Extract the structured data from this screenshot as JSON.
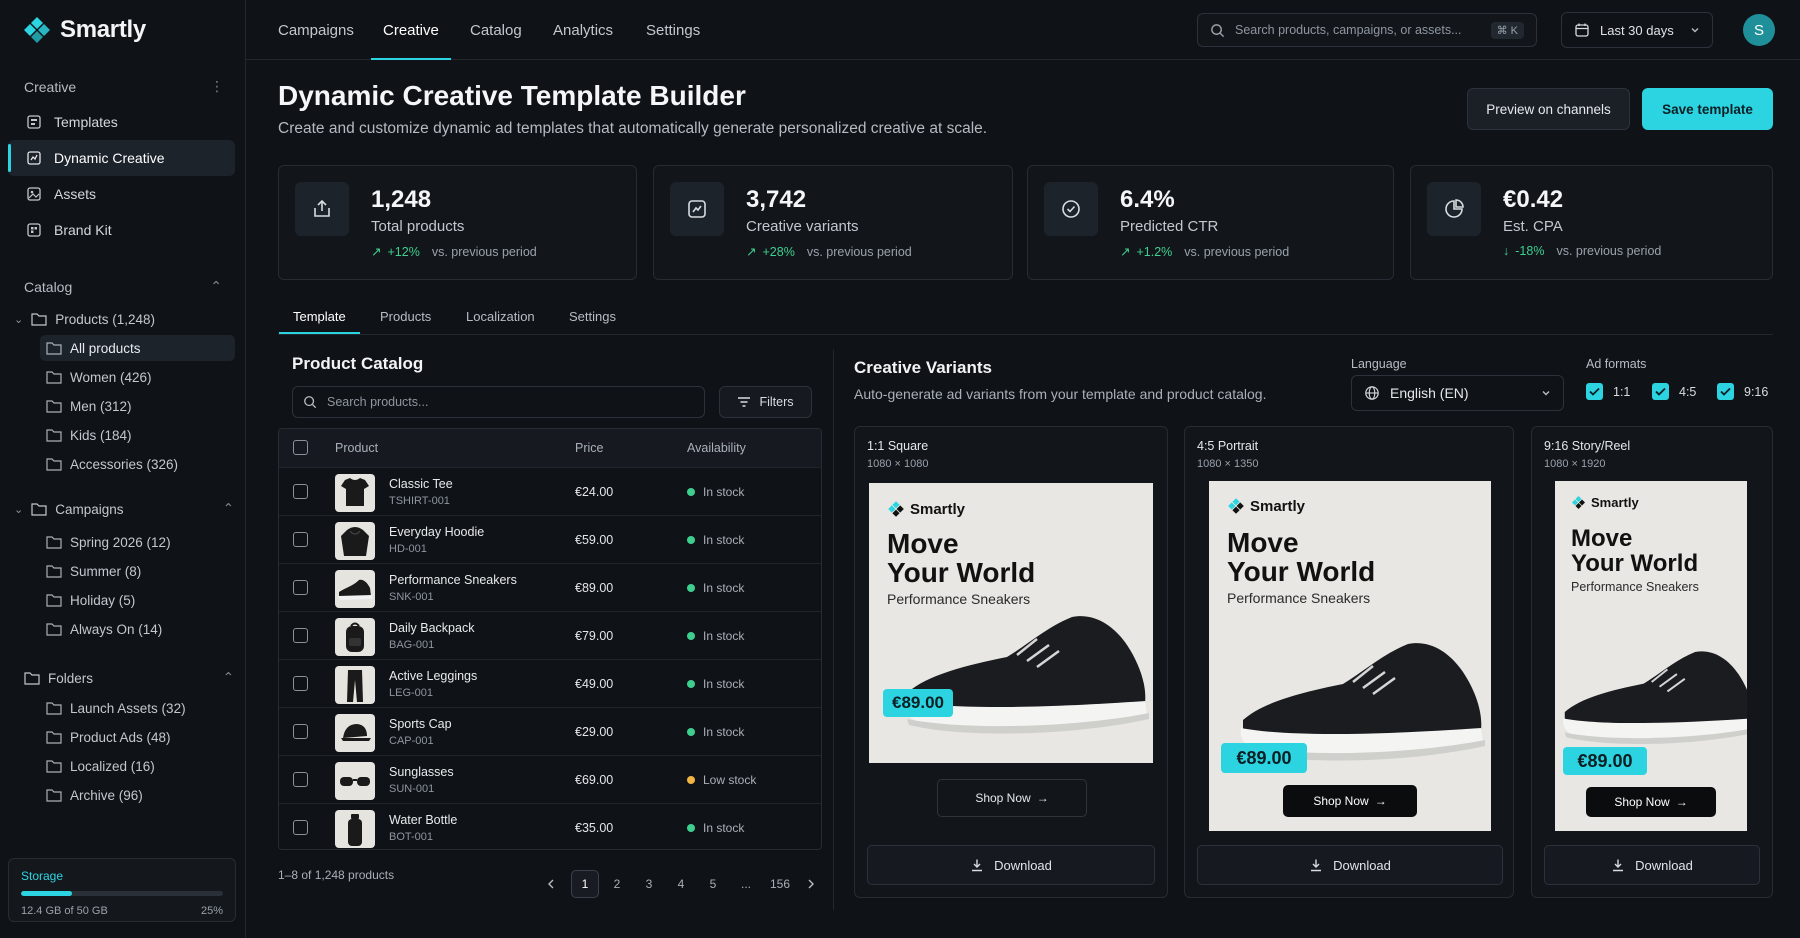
{
  "brand": {
    "name": "Smartly",
    "accent": "#2bd4e0"
  },
  "sidebar": {
    "creative_header": "Creative",
    "creative_items": [
      {
        "label": "Templates",
        "icon": "template-icon"
      },
      {
        "label": "Dynamic Creative",
        "icon": "dynamic-icon",
        "active": true
      },
      {
        "label": "Assets",
        "icon": "image-icon"
      },
      {
        "label": "Brand Kit",
        "icon": "brandkit-icon"
      }
    ],
    "catalog_header": "Catalog",
    "products_group": "Products (1,248)",
    "products_children": [
      "All products",
      "Women (426)",
      "Men (312)",
      "Kids (184)",
      "Accessories (326)"
    ],
    "campaigns_group": "Campaigns",
    "campaigns_children": [
      "Spring 2026 (12)",
      "Summer (8)",
      "Holiday (5)",
      "Always On (14)"
    ],
    "folders_group": "Folders",
    "folders_children": [
      "Launch Assets (32)",
      "Product Ads (48)",
      "Localized (16)",
      "Archive (96)"
    ],
    "storage": {
      "label": "Storage",
      "used": "12.4 GB of 50 GB",
      "percent": "25%",
      "fraction": 0.25
    }
  },
  "topnav": {
    "tabs": [
      "Campaigns",
      "Creative",
      "Catalog",
      "Analytics",
      "Settings"
    ],
    "active": "Creative",
    "search_placeholder": "Search products, campaigns, or assets...",
    "shortcut": "⌘ K",
    "date_range": "Last 30 days",
    "avatar_initial": "S"
  },
  "header": {
    "title": "Dynamic Creative Template Builder",
    "subtitle": "Create and customize dynamic ad templates that automatically generate personalized creative at scale.",
    "preview_button": "Preview on channels",
    "save_button": "Save template"
  },
  "stats": [
    {
      "value": "1,248",
      "label": "Total products",
      "change": "+12%",
      "compare": "vs. previous period",
      "direction": "up"
    },
    {
      "value": "3,742",
      "label": "Creative variants",
      "change": "+28%",
      "compare": "vs. previous period",
      "direction": "up"
    },
    {
      "value": "6.4%",
      "label": "Predicted CTR",
      "change": "+1.2%",
      "compare": "vs. previous period",
      "direction": "up"
    },
    {
      "value": "€0.42",
      "label": "Est. CPA",
      "change": "-18%",
      "compare": "vs. previous period",
      "direction": "down"
    }
  ],
  "subtabs": [
    "Template",
    "Products",
    "Localization",
    "Settings"
  ],
  "catalog": {
    "title": "Product Catalog",
    "search_placeholder": "Search products...",
    "filters_label": "Filters",
    "columns": {
      "product": "Product",
      "price": "Price",
      "availability": "Availability"
    },
    "rows": [
      {
        "name": "Classic Tee",
        "sku": "TSHIRT-001",
        "price": "€24.00",
        "availability": "In stock",
        "status": "ok",
        "thumb": "tshirt-icon"
      },
      {
        "name": "Everyday Hoodie",
        "sku": "HD-001",
        "price": "€59.00",
        "availability": "In stock",
        "status": "ok",
        "thumb": "hoodie-icon"
      },
      {
        "name": "Performance Sneakers",
        "sku": "SNK-001",
        "price": "€89.00",
        "availability": "In stock",
        "status": "ok",
        "thumb": "sneaker-icon"
      },
      {
        "name": "Daily Backpack",
        "sku": "BAG-001",
        "price": "€79.00",
        "availability": "In stock",
        "status": "ok",
        "thumb": "backpack-icon"
      },
      {
        "name": "Active Leggings",
        "sku": "LEG-001",
        "price": "€49.00",
        "availability": "In stock",
        "status": "ok",
        "thumb": "leggings-icon"
      },
      {
        "name": "Sports Cap",
        "sku": "CAP-001",
        "price": "€29.00",
        "availability": "In stock",
        "status": "ok",
        "thumb": "cap-icon"
      },
      {
        "name": "Sunglasses",
        "sku": "SUN-001",
        "price": "€69.00",
        "availability": "Low stock",
        "status": "low",
        "thumb": "sunglasses-icon"
      },
      {
        "name": "Water Bottle",
        "sku": "BOT-001",
        "price": "€35.00",
        "availability": "In stock",
        "status": "ok",
        "thumb": "bottle-icon"
      }
    ],
    "pagination": {
      "summary": "1–8 of 1,248 products",
      "pages": [
        "1",
        "2",
        "3",
        "4",
        "5",
        "...",
        "156"
      ],
      "current": "1"
    }
  },
  "variants": {
    "title": "Creative Variants",
    "subtitle": "Auto-generate ad variants from your template and product catalog.",
    "language_label": "Language",
    "language_value": "English (EN)",
    "formats_label": "Ad formats",
    "formats": [
      "1:1",
      "4:5",
      "9:16"
    ],
    "cards": [
      {
        "name": "1:1 Square",
        "size": "1080 × 1080",
        "brand": "Smartly",
        "headline1": "Move",
        "headline2": "Your World",
        "product": "Performance Sneakers",
        "price": "€89.00",
        "cta": "Shop Now",
        "download": "Download"
      },
      {
        "name": "4:5 Portrait",
        "size": "1080 × 1350",
        "brand": "Smartly",
        "headline1": "Move",
        "headline2": "Your World",
        "product": "Performance Sneakers",
        "price": "€89.00",
        "cta": "Shop Now",
        "download": "Download"
      },
      {
        "name": "9:16 Story/Reel",
        "size": "1080 × 1920",
        "brand": "Smartly",
        "headline1": "Move",
        "headline2": "Your World",
        "product": "Performance Sneakers",
        "price": "€89.00",
        "cta": "Shop Now",
        "download": "Download"
      }
    ]
  },
  "colors": {
    "in_stock": "#3ecf8e",
    "low_stock": "#f2b544",
    "positive": "#3ecf8e"
  }
}
